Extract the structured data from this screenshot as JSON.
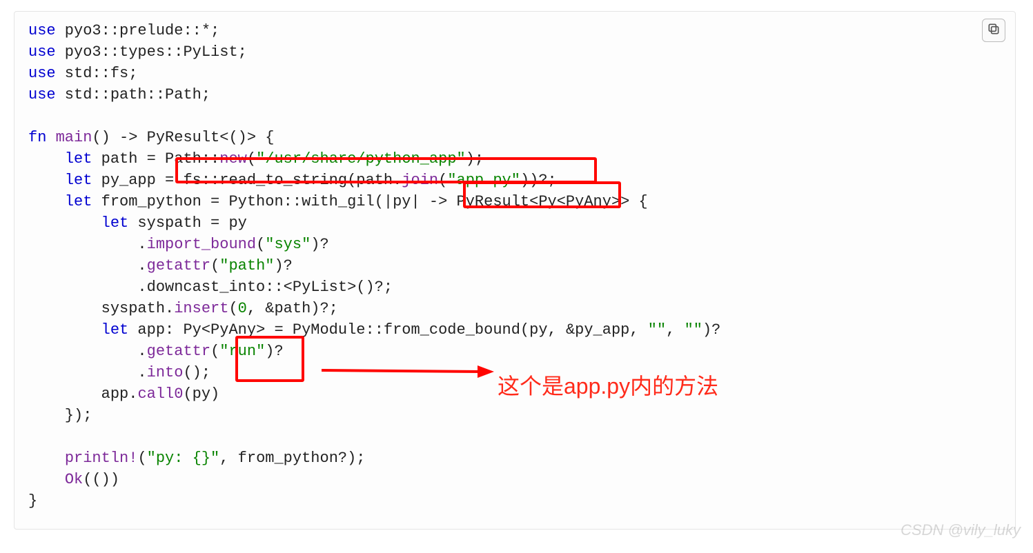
{
  "code": {
    "line1": {
      "a": "use",
      "b": " pyo3::prelude::*;"
    },
    "line2": {
      "a": "use",
      "b": " pyo3::types::PyList;"
    },
    "line3": {
      "a": "use",
      "b": " std::fs;"
    },
    "line4": {
      "a": "use",
      "b": " std::path::Path;"
    },
    "line5": "",
    "line6": {
      "a": "fn ",
      "b": "main",
      "c": "() -> PyResult<()> {"
    },
    "line7": {
      "a": "    ",
      "b": "let",
      "c": " path = Path::",
      "d": "new",
      "e": "(",
      "f": "\"/usr/share/python_app\"",
      "g": ");"
    },
    "line8": {
      "a": "    ",
      "b": "let",
      "c": " py_app = fs::read_to_string(path.",
      "d": "join",
      "e": "(",
      "f": "\"app.py\"",
      "g": "))?;"
    },
    "line9": {
      "a": "    ",
      "b": "let",
      "c": " from_python = Python::with_gil(|py| -> PyResult<Py<PyAny>> {"
    },
    "line10": {
      "a": "        ",
      "b": "let",
      "c": " syspath = py"
    },
    "line11": {
      "a": "            .",
      "b": "import_bound",
      "c": "(",
      "d": "\"sys\"",
      "e": ")?"
    },
    "line12": {
      "a": "            .",
      "b": "getattr",
      "c": "(",
      "d": "\"path\"",
      "e": ")?"
    },
    "line13": {
      "a": "            .downcast_into::<PyList>()?;"
    },
    "line14": {
      "a": "        syspath.",
      "b": "insert",
      "c": "(",
      "d": "0",
      "e": ", &path)?;"
    },
    "line15": {
      "a": "        ",
      "b": "let",
      "c": " app: Py<PyAny> = PyModule::from_code_bound(py, &py_app, ",
      "d": "\"\"",
      "e": ", ",
      "f": "\"\"",
      "g": ")?"
    },
    "line16": {
      "a": "            .",
      "b": "getattr",
      "c": "(",
      "d": "\"run\"",
      "e": ")?"
    },
    "line17": {
      "a": "            .",
      "b": "into",
      "c": "();"
    },
    "line18": {
      "a": "        app.",
      "b": "call0",
      "c": "(py)"
    },
    "line19": "    });",
    "line20": "",
    "line21": {
      "a": "    ",
      "b": "println!",
      "c": "(",
      "d": "\"py: {}\"",
      "e": ", from_python?);"
    },
    "line22": {
      "a": "    ",
      "b": "Ok",
      "c": "(())"
    },
    "line23": "}"
  },
  "annotation": "这个是app.py内的方法",
  "watermark": "CSDN @vily_luky"
}
